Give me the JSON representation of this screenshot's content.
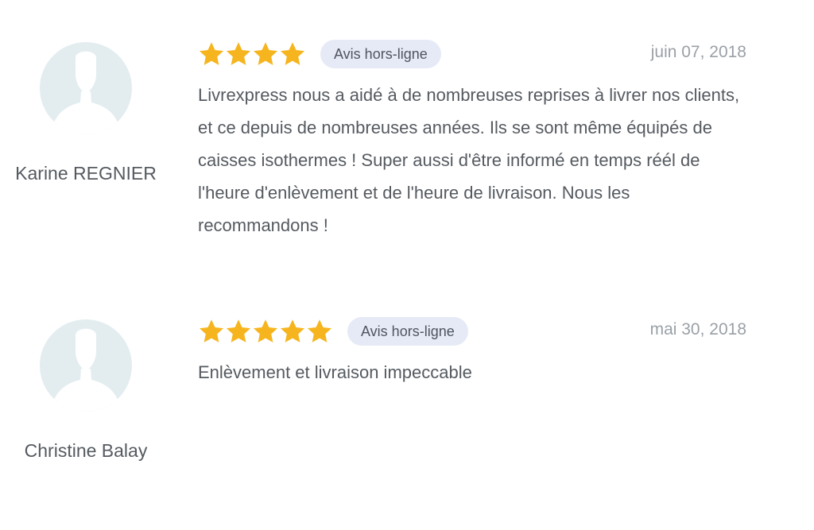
{
  "reviews": [
    {
      "author": "Karine REGNIER",
      "rating": 4,
      "badge": "Avis hors-ligne",
      "date": "juin 07, 2018",
      "text": "Livrexpress nous a aidé à de nombreuses reprises à livrer nos clients, et ce depuis de nombreuses années. Ils se sont même équipés de caisses isothermes ! Super aussi d'être informé en temps réél de l'heure d'enlèvement et de l'heure de livraison. Nous les recommandons !"
    },
    {
      "author": "Christine Balay",
      "rating": 5,
      "badge": "Avis hors-ligne",
      "date": "mai 30, 2018",
      "text": "Enlèvement et livraison impeccable"
    }
  ],
  "colors": {
    "star": "#f6b51e",
    "avatar_bg": "#e3edf0",
    "avatar_fg": "#ffffff",
    "badge_bg": "#e6eaf6",
    "text": "#555a60",
    "date": "#9aa0a6"
  },
  "icons": {
    "avatar": "user-silhouette-icon",
    "rating": "star-icon"
  }
}
